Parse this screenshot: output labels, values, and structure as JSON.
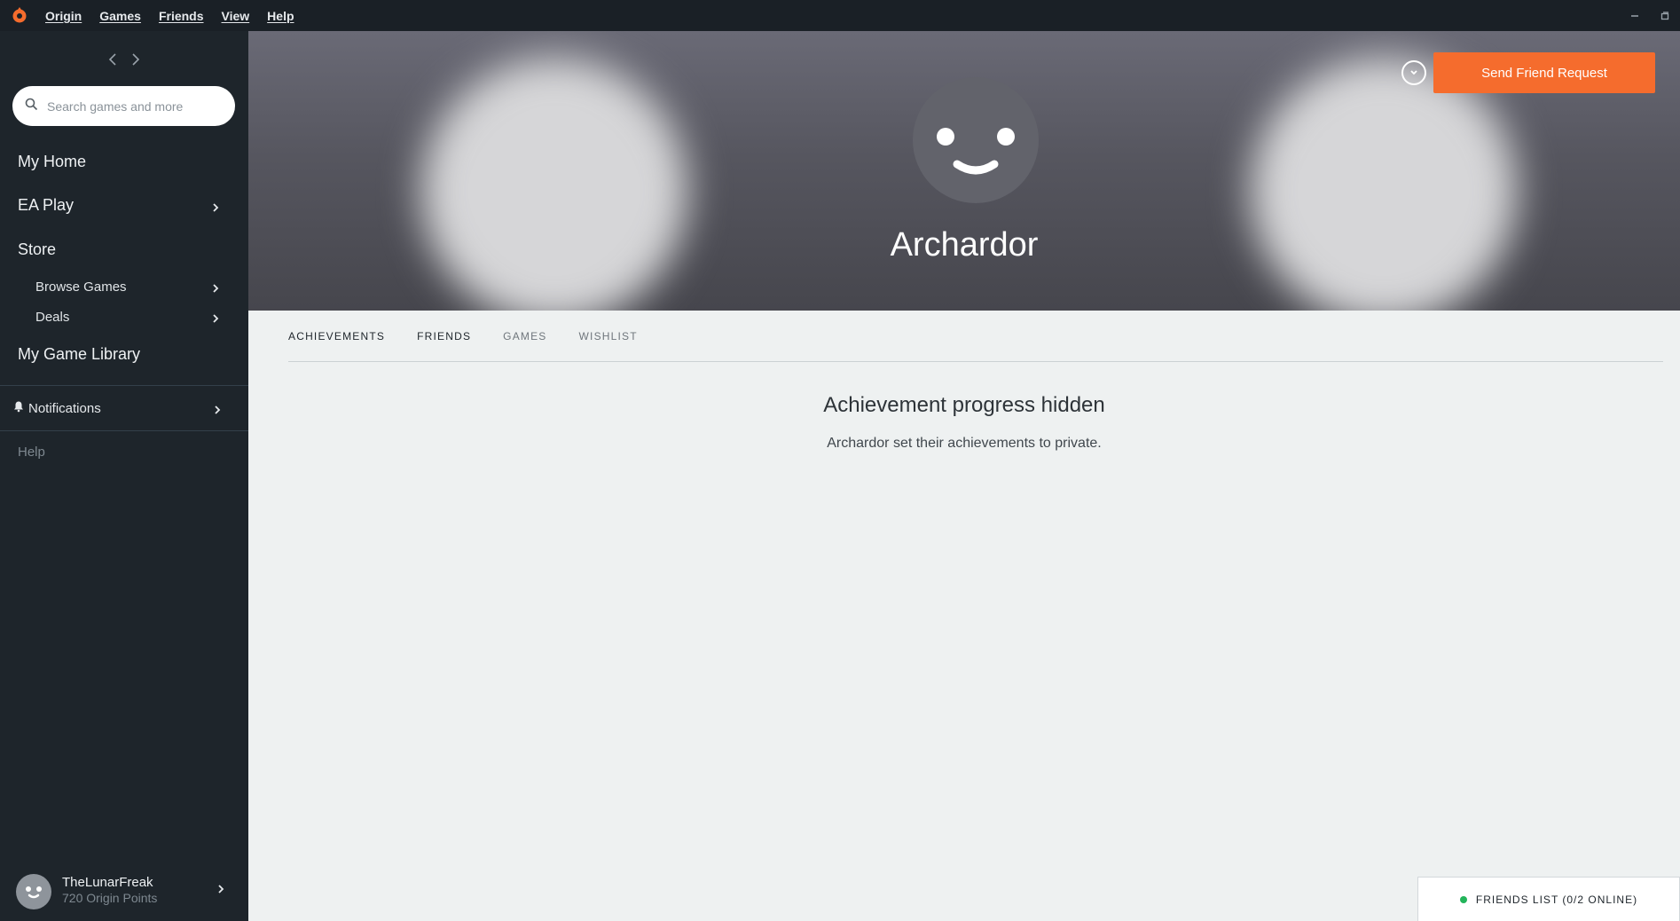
{
  "menubar": {
    "items": [
      "Origin",
      "Games",
      "Friends",
      "View",
      "Help"
    ]
  },
  "sidebar": {
    "search_placeholder": "Search games and more",
    "nav": {
      "my_home": "My Home",
      "ea_play": "EA Play",
      "store": "Store",
      "browse_games": "Browse Games",
      "deals": "Deals",
      "my_game_library": "My Game Library"
    },
    "notifications": "Notifications",
    "help": "Help",
    "user": {
      "name": "TheLunarFreak",
      "points": "720 Origin Points"
    }
  },
  "profile": {
    "name": "Archardor",
    "send_friend_request": "Send Friend Request"
  },
  "tabs": [
    "ACHIEVEMENTS",
    "FRIENDS",
    "GAMES",
    "WISHLIST"
  ],
  "content": {
    "title": "Achievement progress hidden",
    "body": "Archardor set their achievements to private."
  },
  "friends_list": {
    "label": "FRIENDS LIST (0/2 ONLINE)"
  },
  "colors": {
    "accent": "#f56c2d",
    "sidebar_bg": "#1e252b",
    "menubar_bg": "#1a2026",
    "content_bg": "#eef1f1",
    "online": "#23b45a"
  }
}
